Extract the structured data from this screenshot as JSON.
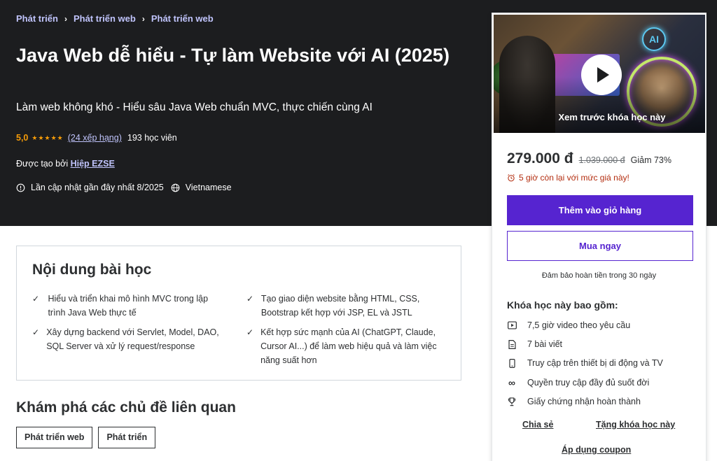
{
  "breadcrumb": [
    "Phát triển",
    "Phát triển web",
    "Phát triển web"
  ],
  "course": {
    "title": "Java Web dễ hiểu - Tự làm Website với AI (2025)",
    "subtitle": "Làm web không khó - Hiểu sâu Java Web chuẩn MVC, thực chiến cùng AI",
    "rating": "5,0",
    "stars": "★★★★★",
    "ratings_link": "(24 xếp hạng)",
    "students": "193 học viên",
    "created_by_label": "Được tạo bởi",
    "instructor": "Hiệp EZSE",
    "last_updated": "Lần cập nhật gần đây nhất 8/2025",
    "language": "Vietnamese"
  },
  "learn": {
    "title": "Nội dung bài học",
    "items": [
      "Hiểu và triển khai mô hình MVC trong lập trình Java Web thực tế",
      "Tạo giao diện website bằng HTML, CSS, Bootstrap kết hợp với JSP, EL và JSTL",
      "Xây dựng backend với Servlet, Model, DAO, SQL Server và xử lý request/response",
      "Kết hợp sức mạnh của AI (ChatGPT, Claude, Cursor AI...) để làm web hiệu quả và làm việc năng suất hơn"
    ]
  },
  "related": {
    "title": "Khám phá các chủ đề liên quan",
    "tags": [
      "Phát triển web",
      "Phát triển"
    ]
  },
  "sidebar": {
    "preview_label": "Xem trước khóa học này",
    "preview_badge": "AI",
    "price_now": "279.000 đ",
    "price_old": "1.039.000 đ",
    "discount": "Giảm 73%",
    "timer": "5 giờ còn lại với mức giá này!",
    "add_to_cart": "Thêm vào giỏ hàng",
    "buy_now": "Mua ngay",
    "guarantee": "Đảm bảo hoàn tiền trong 30 ngày",
    "includes_title": "Khóa học này bao gồm:",
    "includes": [
      {
        "icon": "video-icon",
        "label": "7,5 giờ video theo yêu cầu"
      },
      {
        "icon": "article-icon",
        "label": "7 bài viết"
      },
      {
        "icon": "mobile-icon",
        "label": "Truy cập trên thiết bị di động và TV"
      },
      {
        "icon": "infinity-icon",
        "label": "Quyền truy cập đầy đủ suốt đời"
      },
      {
        "icon": "trophy-icon",
        "label": "Giấy chứng nhận hoàn thành"
      }
    ],
    "share": "Chia sẻ",
    "gift": "Tặng khóa học này",
    "coupon": "Áp dụng coupon"
  },
  "colors": {
    "hero_bg": "#1c1d1f",
    "accent": "#5624d0",
    "link_light": "#c0c4fc",
    "star": "#f69c08",
    "warning": "#b32d0f"
  }
}
